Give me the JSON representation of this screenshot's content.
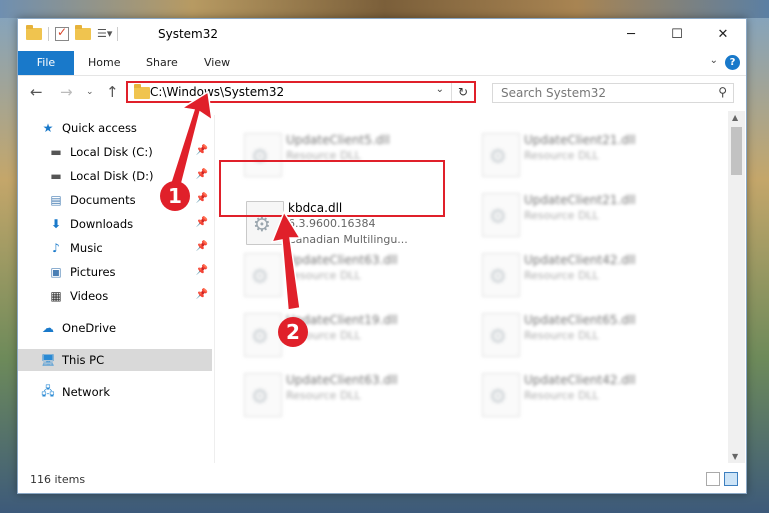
{
  "window": {
    "title": "System32",
    "controls": {
      "minimize": "─",
      "maximize": "☐",
      "close": "✕"
    }
  },
  "ribbon": {
    "tabs": [
      "File",
      "Home",
      "Share",
      "View"
    ],
    "help": "?"
  },
  "nav": {
    "address": "C:\\Windows\\System32",
    "search_placeholder": "Search System32"
  },
  "sidebar": {
    "items": [
      {
        "label": "Quick access",
        "icon": "star-icon"
      },
      {
        "label": "Local Disk (C:)",
        "icon": "drive-icon",
        "pinned": true
      },
      {
        "label": "Local Disk (D:)",
        "icon": "drive-icon",
        "pinned": true
      },
      {
        "label": "Documents",
        "icon": "documents-icon",
        "pinned": true
      },
      {
        "label": "Downloads",
        "icon": "downloads-icon",
        "pinned": true
      },
      {
        "label": "Music",
        "icon": "music-icon",
        "pinned": true
      },
      {
        "label": "Pictures",
        "icon": "pictures-icon",
        "pinned": true
      },
      {
        "label": "Videos",
        "icon": "videos-icon",
        "pinned": true
      },
      {
        "label": "OneDrive",
        "icon": "cloud-icon"
      },
      {
        "label": "This PC",
        "icon": "computer-icon",
        "selected": true
      },
      {
        "label": "Network",
        "icon": "network-icon"
      }
    ]
  },
  "files": {
    "left_col": [
      {
        "name": "UpdateClient5.dll",
        "type": "Resource DLL"
      },
      {
        "name": "kbdca.dll",
        "version": "6.3.9600.16384",
        "desc": "Canadian Multilingu..."
      },
      {
        "name": "UpdateClient63.dll",
        "type": "Resource DLL"
      },
      {
        "name": "UpdateClient19.dll",
        "type": "Resource DLL"
      },
      {
        "name": "UpdateClient63.dll",
        "type": "Resource DLL"
      }
    ],
    "right_col": [
      {
        "name": "UpdateClient21.dll",
        "type": "Resource DLL"
      },
      {
        "name": "UpdateClient21.dll",
        "type": "Resource DLL"
      },
      {
        "name": "UpdateClient42.dll",
        "type": "Resource DLL"
      },
      {
        "name": "UpdateClient65.dll",
        "type": "Resource DLL"
      },
      {
        "name": "UpdateClient42.dll",
        "type": "Resource DLL"
      }
    ]
  },
  "status": {
    "count": "116 items"
  },
  "callouts": {
    "one": "1",
    "two": "2"
  },
  "colors": {
    "accent": "#1979ca",
    "highlight": "#e0202a"
  }
}
